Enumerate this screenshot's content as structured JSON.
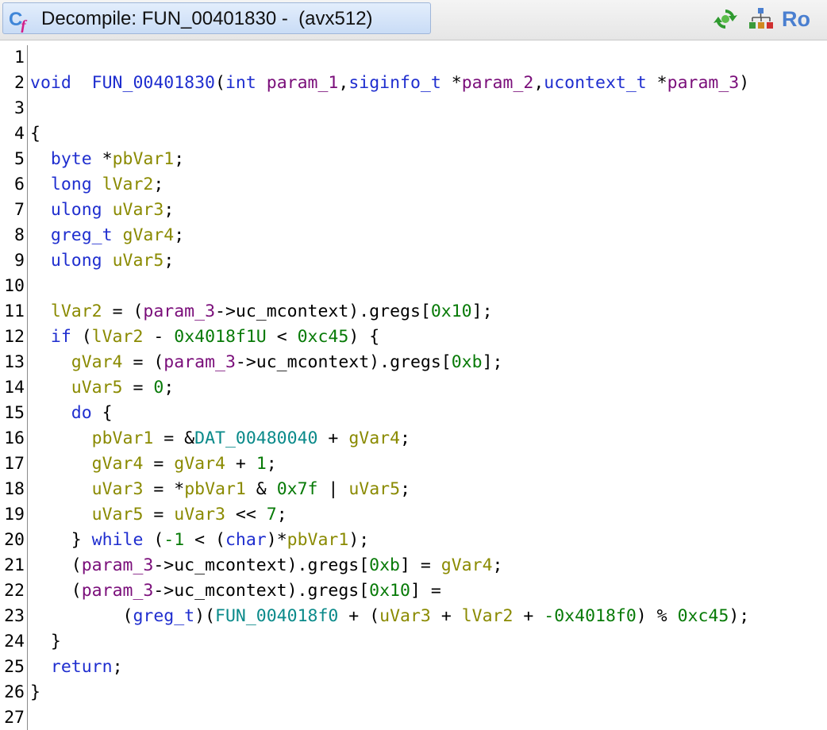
{
  "tab": {
    "title": "Decompile: FUN_00401830 -  (avx512)",
    "icon": "decompile-function-icon"
  },
  "toolbar": {
    "refresh_icon": "refresh-icon",
    "graph_icon": "call-graph-icon",
    "ro_label": "Ro"
  },
  "colors": {
    "keyword": "#1f2ecf",
    "local_variable": "#8a8a00",
    "parameter": "#7a0e7a",
    "constant": "#077a07",
    "global": "#0a8a8a"
  },
  "lines": [
    {
      "n": "1",
      "tokens": []
    },
    {
      "n": "2",
      "tokens": [
        [
          "k",
          "void"
        ],
        [
          "",
          "  "
        ],
        [
          "f",
          "FUN_00401830"
        ],
        [
          "",
          "("
        ],
        [
          "k",
          "int"
        ],
        [
          "",
          " "
        ],
        [
          "p",
          "param_1"
        ],
        [
          "",
          ","
        ],
        [
          "k",
          "siginfo_t"
        ],
        [
          "",
          " *"
        ],
        [
          "p",
          "param_2"
        ],
        [
          "",
          ","
        ],
        [
          "k",
          "ucontext_t"
        ],
        [
          "",
          " *"
        ],
        [
          "p",
          "param_3"
        ],
        [
          "",
          ")"
        ]
      ]
    },
    {
      "n": "3",
      "tokens": []
    },
    {
      "n": "4",
      "tokens": [
        [
          "",
          "{"
        ]
      ]
    },
    {
      "n": "5",
      "tokens": [
        [
          "",
          "  "
        ],
        [
          "k",
          "byte"
        ],
        [
          "",
          " *"
        ],
        [
          "v",
          "pbVar1"
        ],
        [
          "",
          ";"
        ]
      ]
    },
    {
      "n": "6",
      "tokens": [
        [
          "",
          "  "
        ],
        [
          "k",
          "long"
        ],
        [
          "",
          " "
        ],
        [
          "v",
          "lVar2"
        ],
        [
          "",
          ";"
        ]
      ]
    },
    {
      "n": "7",
      "tokens": [
        [
          "",
          "  "
        ],
        [
          "k",
          "ulong"
        ],
        [
          "",
          " "
        ],
        [
          "v",
          "uVar3"
        ],
        [
          "",
          ";"
        ]
      ]
    },
    {
      "n": "8",
      "tokens": [
        [
          "",
          "  "
        ],
        [
          "k",
          "greg_t"
        ],
        [
          "",
          " "
        ],
        [
          "v",
          "gVar4"
        ],
        [
          "",
          ";"
        ]
      ]
    },
    {
      "n": "9",
      "tokens": [
        [
          "",
          "  "
        ],
        [
          "k",
          "ulong"
        ],
        [
          "",
          " "
        ],
        [
          "v",
          "uVar5"
        ],
        [
          "",
          ";"
        ]
      ]
    },
    {
      "n": "10",
      "tokens": []
    },
    {
      "n": "11",
      "tokens": [
        [
          "",
          "  "
        ],
        [
          "v",
          "lVar2"
        ],
        [
          "",
          " = ("
        ],
        [
          "p",
          "param_3"
        ],
        [
          "",
          "->uc_mcontext).gregs["
        ],
        [
          "c",
          "0x10"
        ],
        [
          "",
          "];"
        ]
      ]
    },
    {
      "n": "12",
      "tokens": [
        [
          "",
          "  "
        ],
        [
          "k",
          "if"
        ],
        [
          "",
          " ("
        ],
        [
          "v",
          "lVar2"
        ],
        [
          "",
          " - "
        ],
        [
          "c",
          "0x4018f1U"
        ],
        [
          "",
          " < "
        ],
        [
          "c",
          "0xc45"
        ],
        [
          "",
          ") {"
        ]
      ]
    },
    {
      "n": "13",
      "tokens": [
        [
          "",
          "    "
        ],
        [
          "v",
          "gVar4"
        ],
        [
          "",
          " = ("
        ],
        [
          "p",
          "param_3"
        ],
        [
          "",
          "->uc_mcontext).gregs["
        ],
        [
          "c",
          "0xb"
        ],
        [
          "",
          "];"
        ]
      ]
    },
    {
      "n": "14",
      "tokens": [
        [
          "",
          "    "
        ],
        [
          "v",
          "uVar5"
        ],
        [
          "",
          " = "
        ],
        [
          "c",
          "0"
        ],
        [
          "",
          ";"
        ]
      ]
    },
    {
      "n": "15",
      "tokens": [
        [
          "",
          "    "
        ],
        [
          "k",
          "do"
        ],
        [
          "",
          " {"
        ]
      ]
    },
    {
      "n": "16",
      "tokens": [
        [
          "",
          "      "
        ],
        [
          "v",
          "pbVar1"
        ],
        [
          "",
          " = &"
        ],
        [
          "g",
          "DAT_00480040"
        ],
        [
          "",
          " + "
        ],
        [
          "v",
          "gVar4"
        ],
        [
          "",
          ";"
        ]
      ]
    },
    {
      "n": "17",
      "tokens": [
        [
          "",
          "      "
        ],
        [
          "v",
          "gVar4"
        ],
        [
          "",
          " = "
        ],
        [
          "v",
          "gVar4"
        ],
        [
          "",
          " + "
        ],
        [
          "c",
          "1"
        ],
        [
          "",
          ";"
        ]
      ]
    },
    {
      "n": "18",
      "tokens": [
        [
          "",
          "      "
        ],
        [
          "v",
          "uVar3"
        ],
        [
          "",
          " = *"
        ],
        [
          "v",
          "pbVar1"
        ],
        [
          "",
          " & "
        ],
        [
          "c",
          "0x7f"
        ],
        [
          "",
          " | "
        ],
        [
          "v",
          "uVar5"
        ],
        [
          "",
          ";"
        ]
      ]
    },
    {
      "n": "19",
      "tokens": [
        [
          "",
          "      "
        ],
        [
          "v",
          "uVar5"
        ],
        [
          "",
          " = "
        ],
        [
          "v",
          "uVar3"
        ],
        [
          "",
          " << "
        ],
        [
          "c",
          "7"
        ],
        [
          "",
          ";"
        ]
      ]
    },
    {
      "n": "20",
      "tokens": [
        [
          "",
          "    } "
        ],
        [
          "k",
          "while"
        ],
        [
          "",
          " ("
        ],
        [
          "c",
          "-1"
        ],
        [
          "",
          " < ("
        ],
        [
          "k",
          "char"
        ],
        [
          "",
          ")*"
        ],
        [
          "v",
          "pbVar1"
        ],
        [
          "",
          ");"
        ]
      ]
    },
    {
      "n": "21",
      "tokens": [
        [
          "",
          "    ("
        ],
        [
          "p",
          "param_3"
        ],
        [
          "",
          "->uc_mcontext).gregs["
        ],
        [
          "c",
          "0xb"
        ],
        [
          "",
          "] = "
        ],
        [
          "v",
          "gVar4"
        ],
        [
          "",
          ";"
        ]
      ]
    },
    {
      "n": "22",
      "tokens": [
        [
          "",
          "    ("
        ],
        [
          "p",
          "param_3"
        ],
        [
          "",
          "->uc_mcontext).gregs["
        ],
        [
          "c",
          "0x10"
        ],
        [
          "",
          "] ="
        ]
      ]
    },
    {
      "n": "23",
      "tokens": [
        [
          "",
          "         ("
        ],
        [
          "k",
          "greg_t"
        ],
        [
          "",
          ")("
        ],
        [
          "g",
          "FUN_004018f0"
        ],
        [
          "",
          " + ("
        ],
        [
          "v",
          "uVar3"
        ],
        [
          "",
          " + "
        ],
        [
          "v",
          "lVar2"
        ],
        [
          "",
          " + "
        ],
        [
          "c",
          "-0x4018f0"
        ],
        [
          "",
          ") % "
        ],
        [
          "c",
          "0xc45"
        ],
        [
          "",
          ");"
        ]
      ]
    },
    {
      "n": "24",
      "tokens": [
        [
          "",
          "  }"
        ]
      ]
    },
    {
      "n": "25",
      "tokens": [
        [
          "",
          "  "
        ],
        [
          "k",
          "return"
        ],
        [
          "",
          ";"
        ]
      ]
    },
    {
      "n": "26",
      "tokens": [
        [
          "",
          "}"
        ]
      ]
    },
    {
      "n": "27",
      "tokens": []
    }
  ]
}
